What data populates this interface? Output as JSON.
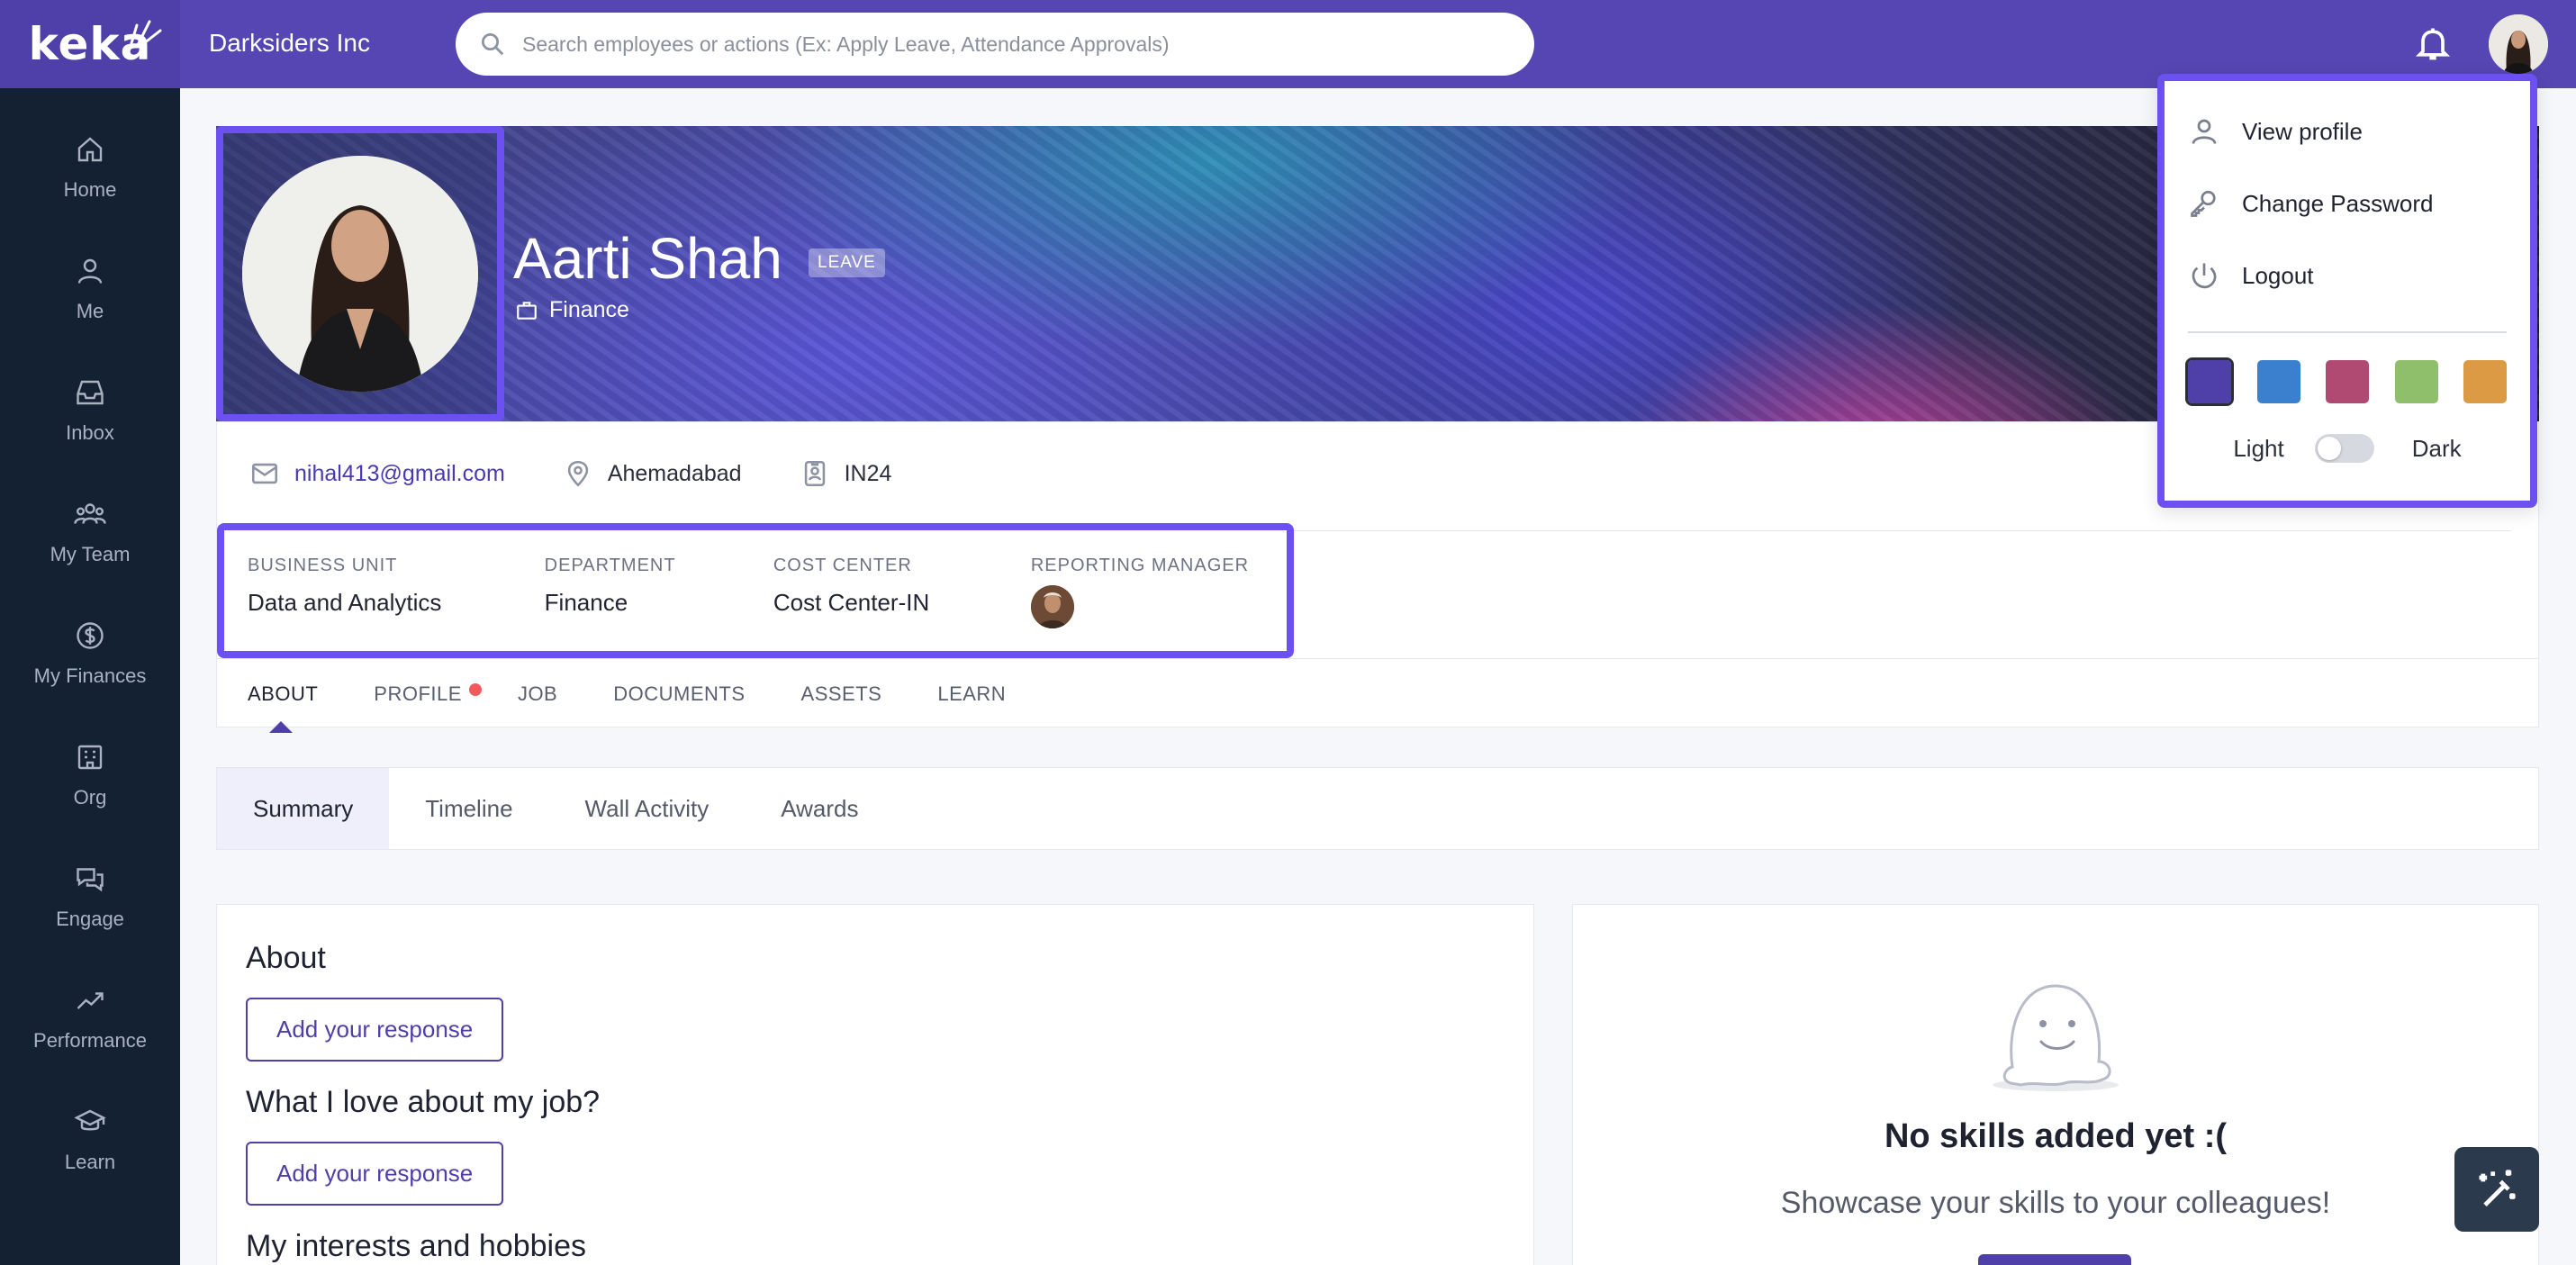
{
  "app": {
    "logo": "keka",
    "company": "Darksiders Inc"
  },
  "search": {
    "placeholder": "Search employees or actions (Ex: Apply Leave, Attendance Approvals)"
  },
  "sidebar": {
    "items": [
      {
        "label": "Home",
        "icon": "home-icon"
      },
      {
        "label": "Me",
        "icon": "user-icon"
      },
      {
        "label": "Inbox",
        "icon": "inbox-icon"
      },
      {
        "label": "My Team",
        "icon": "team-icon"
      },
      {
        "label": "My Finances",
        "icon": "dollar-icon"
      },
      {
        "label": "Org",
        "icon": "building-icon"
      },
      {
        "label": "Engage",
        "icon": "chat-icon"
      },
      {
        "label": "Performance",
        "icon": "trend-icon"
      },
      {
        "label": "Learn",
        "icon": "graduation-cap-icon"
      }
    ]
  },
  "profile": {
    "name": "Aarti Shah",
    "badge": "LEAVE",
    "department": "Finance",
    "email": "nihal413@gmail.com",
    "location": "Ahemadabad",
    "employee_id": "IN24"
  },
  "meta": {
    "business_unit_label": "BUSINESS UNIT",
    "business_unit": "Data and Analytics",
    "department_label": "DEPARTMENT",
    "department": "Finance",
    "cost_center_label": "COST CENTER",
    "cost_center": "Cost Center-IN",
    "reporting_manager_label": "REPORTING MANAGER"
  },
  "tabs": [
    "ABOUT",
    "PROFILE",
    "JOB",
    "DOCUMENTS",
    "ASSETS",
    "LEARN"
  ],
  "subtabs": [
    "Summary",
    "Timeline",
    "Wall Activity",
    "Awards"
  ],
  "about": {
    "title": "About",
    "love_title": "What I love about my job?",
    "hobbies_title": "My interests and hobbies",
    "response_button": "Add your response"
  },
  "skills": {
    "title": "No skills added yet :(",
    "subtitle": "Showcase your skills to your colleagues!"
  },
  "dropdown": {
    "view_profile": "View profile",
    "change_password": "Change Password",
    "logout": "Logout",
    "swatches": [
      "#4f3fa9",
      "#3a80cf",
      "#b14a72",
      "#8fbf6a",
      "#dc9a45"
    ],
    "light_label": "Light",
    "dark_label": "Dark"
  }
}
